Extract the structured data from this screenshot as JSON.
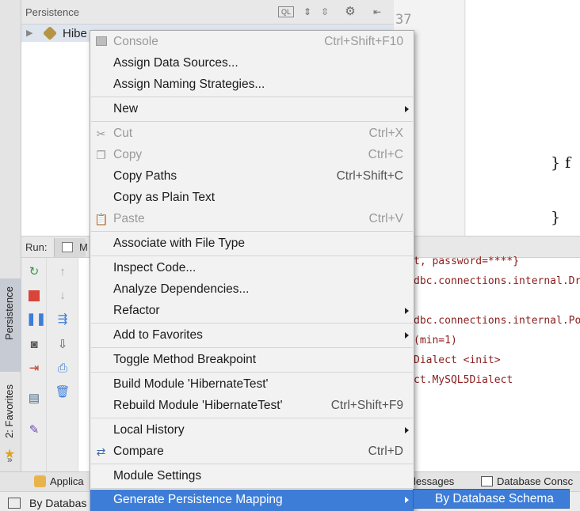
{
  "persistence_panel": {
    "title": "Persistence",
    "tree_item": "Hibe"
  },
  "editor": {
    "line_number": "37",
    "code_lines": [
      "} f",
      "}"
    ]
  },
  "left_stripe": {
    "persistence_tab": "Persistence",
    "favorites_tab": "2: Favorites"
  },
  "run_window": {
    "label": "Run:",
    "tab_partial": "M",
    "console_lines": [
      "t, password=****}",
      "dbc.connections.internal.Dr",
      "dbc.connections.internal.Po",
      " (min=1)",
      "Dialect <init>",
      "ct.MySQL5Dialect"
    ]
  },
  "bottom_tabs": {
    "applica": "Applica",
    "messages": "lessages",
    "database_console": "Database Consc"
  },
  "status_bar": {
    "text": "By Databas"
  },
  "context_menu": {
    "items": [
      {
        "label": "Console",
        "shortcut": "Ctrl+Shift+F10",
        "disabled": true,
        "icon": "console-icon"
      },
      {
        "label": "Assign Data Sources..."
      },
      {
        "label": "Assign Naming Strategies..."
      },
      {
        "label": "New",
        "submenu": true
      },
      {
        "label": "Cut",
        "shortcut": "Ctrl+X",
        "disabled": true,
        "icon": "scissors-icon"
      },
      {
        "label": "Copy",
        "shortcut": "Ctrl+C",
        "disabled": true,
        "icon": "copy-icon"
      },
      {
        "label": "Copy Paths",
        "shortcut": "Ctrl+Shift+C"
      },
      {
        "label": "Copy as Plain Text"
      },
      {
        "label": "Paste",
        "shortcut": "Ctrl+V",
        "disabled": true,
        "icon": "paste-icon"
      },
      {
        "label": "Associate with File Type"
      },
      {
        "label": "Inspect Code..."
      },
      {
        "label": "Analyze Dependencies..."
      },
      {
        "label": "Refactor",
        "submenu": true
      },
      {
        "label": "Add to Favorites",
        "submenu": true
      },
      {
        "label": "Toggle Method Breakpoint"
      },
      {
        "label": "Build Module 'HibernateTest'"
      },
      {
        "label": "Rebuild Module 'HibernateTest'",
        "shortcut": "Ctrl+Shift+F9"
      },
      {
        "label": "Local History",
        "submenu": true
      },
      {
        "label": "Compare",
        "shortcut": "Ctrl+D",
        "icon": "compare-icon"
      },
      {
        "label": "Module Settings"
      },
      {
        "label": "Generate Persistence Mapping",
        "submenu": true,
        "selected": true
      }
    ]
  },
  "submenu": {
    "item": "By Database Schema"
  },
  "colors": {
    "selection": "#3d7dd8",
    "menu_background": "#f2f2f2"
  }
}
